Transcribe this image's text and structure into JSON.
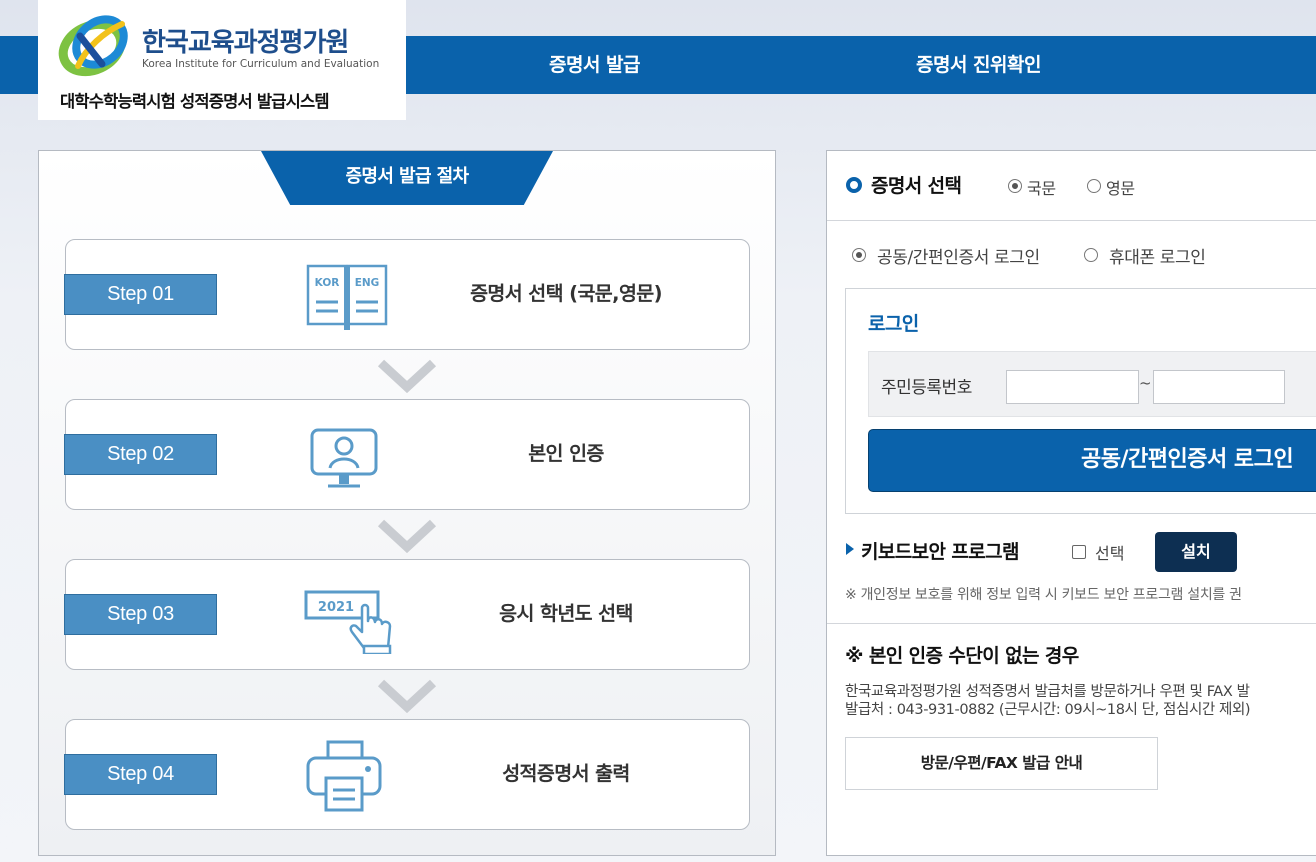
{
  "header": {
    "org_name_kor": "한국교육과정평가원",
    "org_name_eng": "Korea Institute for Curriculum and Evaluation",
    "system_name": "대학수학능력시험 성적증명서 발급시스템",
    "nav": [
      {
        "label": "증명서 발급"
      },
      {
        "label": "증명서 진위확인"
      }
    ],
    "brand_color": "#0a62ab"
  },
  "procedure": {
    "title": "증명서 발급 절차",
    "steps": [
      {
        "badge": "Step 01",
        "text": "증명서 선택 (국문,영문)",
        "icon": "book-kor-eng-icon",
        "icon_labels": [
          "KOR",
          "ENG"
        ]
      },
      {
        "badge": "Step 02",
        "text": "본인 인증",
        "icon": "monitor-user-icon"
      },
      {
        "badge": "Step 03",
        "text": "응시 학년도 선택",
        "icon": "touch-year-icon",
        "icon_label": "2021"
      },
      {
        "badge": "Step 04",
        "text": "성적증명서 출력",
        "icon": "printer-icon"
      }
    ]
  },
  "certificate": {
    "title": "증명서 선택",
    "options": [
      {
        "label": "국문",
        "selected": true
      },
      {
        "label": "영문",
        "selected": false
      }
    ]
  },
  "login_method": {
    "options": [
      {
        "label": "공동/간편인증서 로그인",
        "selected": true
      },
      {
        "label": "휴대폰 로그인",
        "selected": false
      }
    ]
  },
  "login": {
    "title": "로그인",
    "id_label": "주민등록번호",
    "id_first": "",
    "id_second": "",
    "separator": "~",
    "button_label": "공동/간편인증서 로그인"
  },
  "keyboard": {
    "label": "키보드보안 프로그램",
    "checkbox_label": "선택",
    "checked": false,
    "install_label": "설치",
    "note": "※ 개인정보 보호를 위해 정보 입력 시 키보드 보안 프로그램 설치를 권"
  },
  "no_auth": {
    "title": "※ 본인 인증 수단이 없는 경우",
    "line1": "한국교육과정평가원 성적증명서 발급처를 방문하거나 우편 및 FAX 발",
    "line2": "발급처 : 043-931-0882 (근무시간: 09시~18시 단, 점심시간 제외)",
    "button_label": "방문/우편/FAX 발급 안내"
  }
}
